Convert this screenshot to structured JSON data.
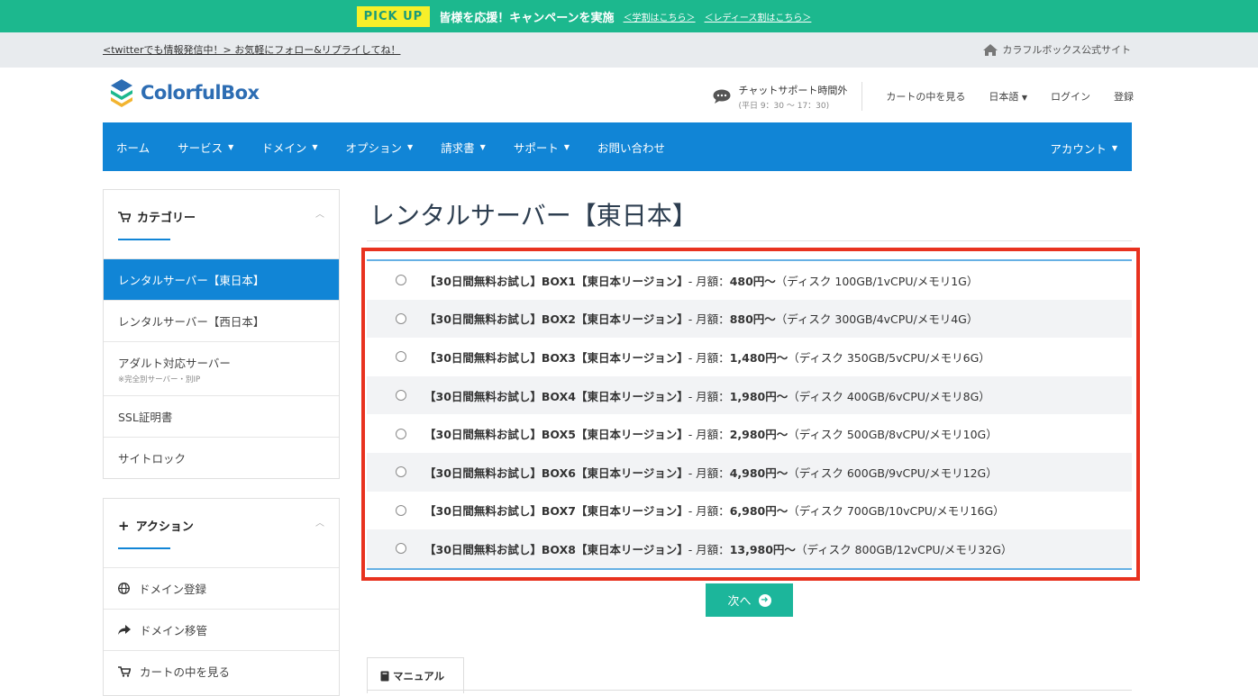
{
  "promo": {
    "badge": "PICK UP",
    "text": "皆様を応援！キャンペーンを実施",
    "link1": "＜学割はこちら＞",
    "link2": "＜レディース割はこちら＞"
  },
  "infobar": {
    "twitter": "<twitterでも情報発信中！> お気軽にフォロー&リプライしてね！",
    "official": "カラフルボックス公式サイト"
  },
  "header": {
    "logo": "ColorfulBox",
    "chat_main": "チャットサポート時間外",
    "chat_sub": "(平日 9：30 〜 17：30)",
    "cart": "カートの中を見る",
    "language": "日本語",
    "login": "ログイン",
    "register": "登録"
  },
  "nav": {
    "items": [
      "ホーム",
      "サービス",
      "ドメイン",
      "オプション",
      "請求書",
      "サポート",
      "お問い合わせ"
    ],
    "account": "アカウント"
  },
  "sidebar": {
    "category_title": "カテゴリー",
    "categories": [
      {
        "label": "レンタルサーバー【東日本】",
        "note": ""
      },
      {
        "label": "レンタルサーバー【西日本】",
        "note": ""
      },
      {
        "label": "アダルト対応サーバー",
        "note": "※完全別サーバー・別IP"
      },
      {
        "label": "SSL証明書",
        "note": ""
      },
      {
        "label": "サイトロック",
        "note": ""
      }
    ],
    "action_title": "アクション",
    "actions": [
      "ドメイン登録",
      "ドメイン移管",
      "カートの中を見る"
    ]
  },
  "main": {
    "title": "レンタルサーバー【東日本】",
    "plans": [
      {
        "name": "【30日間無料お試し】BOX1【東日本リージョン】",
        "price": " - 月額：",
        "amount": "480円〜",
        "spec": "（ディスク 100GB/1vCPU/メモリ1G）"
      },
      {
        "name": "【30日間無料お試し】BOX2【東日本リージョン】",
        "price": " - 月額：",
        "amount": "880円〜",
        "spec": "（ディスク 300GB/4vCPU/メモリ4G）"
      },
      {
        "name": "【30日間無料お試し】BOX3【東日本リージョン】",
        "price": " - 月額：",
        "amount": "1,480円〜",
        "spec": "（ディスク 350GB/5vCPU/メモリ6G）"
      },
      {
        "name": "【30日間無料お試し】BOX4【東日本リージョン】",
        "price": " - 月額：",
        "amount": "1,980円〜",
        "spec": "（ディスク 400GB/6vCPU/メモリ8G）"
      },
      {
        "name": "【30日間無料お試し】BOX5【東日本リージョン】",
        "price": " - 月額：",
        "amount": "2,980円〜",
        "spec": "（ディスク 500GB/8vCPU/メモリ10G）"
      },
      {
        "name": "【30日間無料お試し】BOX6【東日本リージョン】",
        "price": " - 月額：",
        "amount": "4,980円〜",
        "spec": "（ディスク 600GB/9vCPU/メモリ12G）"
      },
      {
        "name": "【30日間無料お試し】BOX7【東日本リージョン】",
        "price": " - 月額：",
        "amount": "6,980円〜",
        "spec": "（ディスク 700GB/10vCPU/メモリ16G）"
      },
      {
        "name": "【30日間無料お試し】BOX8【東日本リージョン】",
        "price": " - 月額：",
        "amount": "13,980円〜",
        "spec": "（ディスク 800GB/12vCPU/メモリ32G）"
      }
    ],
    "next": "次へ",
    "manual_tab": "マニュアル"
  },
  "colors": {
    "brand_green": "#1cb88e",
    "nav_blue": "#1185d6",
    "highlight_red": "#e8321f",
    "button_teal": "#1cb69b"
  }
}
